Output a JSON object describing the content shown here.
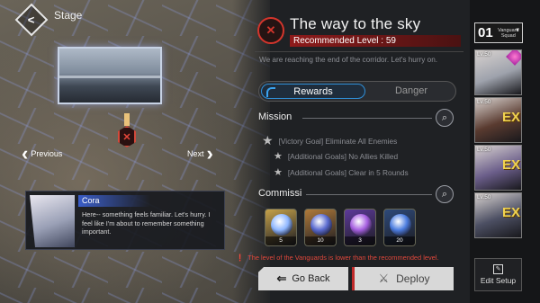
{
  "header": {
    "back_icon": "chevron-left-icon",
    "stage_label": "Stage"
  },
  "map": {
    "prev_label": "Previous",
    "next_label": "Next",
    "node_icon": "crossed-swords-icon"
  },
  "dialog": {
    "speaker": "Cora",
    "text": "Here-- something feels familiar. Let's hurry. I feel like I'm about to remember something important."
  },
  "stage": {
    "title": "The way to the sky",
    "recommended_label": "Recommended Level : 59",
    "description": "We are reaching the end of the corridor. Let's hurry on.",
    "tabs": [
      {
        "label": "Rewards",
        "active": true
      },
      {
        "label": "Danger",
        "active": false
      }
    ]
  },
  "mission": {
    "heading": "Mission",
    "goals": [
      {
        "text": "[Victory Goal] Eliminate All Enemies",
        "main": true
      },
      {
        "text": "[Additional Goals] No Allies Killed",
        "main": false
      },
      {
        "text": "[Additional Goals] Clear in 5 Rounds",
        "main": false
      }
    ]
  },
  "commission": {
    "heading": "Commissi",
    "rewards": [
      {
        "icon": "butterfly-crystal-icon",
        "count": "5",
        "frame": "#c6a24a",
        "color": "#8fb7ff"
      },
      {
        "icon": "orb-icon",
        "count": "10",
        "frame": "#b07a3a",
        "color": "#5b6bd0"
      },
      {
        "icon": "gem-icon",
        "count": "3",
        "frame": "#5d3a9a",
        "color": "#a65fe0"
      },
      {
        "icon": "gem-icon",
        "count": "20",
        "frame": "#2e4a7a",
        "color": "#4c7de0"
      }
    ]
  },
  "warning": {
    "icon": "exclamation-icon",
    "text": "The level of the Vanguards is lower than the recommended level."
  },
  "buttons": {
    "back": "Go Back",
    "deploy": "Deploy",
    "edit": "Edit Setup"
  },
  "squad": {
    "number": "01",
    "label": "Vanguard Squad"
  },
  "characters": [
    {
      "level": "Lv.50",
      "ex": "",
      "bg": "#9ea2ac"
    },
    {
      "level": "Lv.50",
      "ex": "EX",
      "bg": "#5a3b30"
    },
    {
      "level": "Lv.50",
      "ex": "EX",
      "bg": "#6b5e8a"
    },
    {
      "level": "Lv.50",
      "ex": "EX",
      "bg": "#4c4f63"
    }
  ],
  "colors": {
    "accent_red": "#d3352c",
    "accent_blue": "#2f8fd8"
  }
}
